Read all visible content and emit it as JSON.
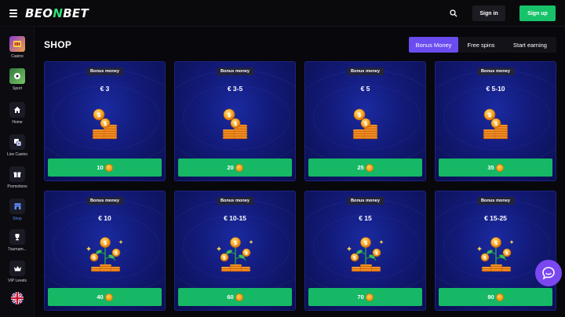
{
  "header": {
    "brand_main": "BEO",
    "brand_accent": "N",
    "brand_end": "BET",
    "signin_label": "Sign in",
    "signup_label": "Sign up"
  },
  "sidebar": {
    "items": [
      {
        "label": "Casino",
        "icon": "slot-machine-icon"
      },
      {
        "label": "Sport",
        "icon": "football-field-icon"
      },
      {
        "label": "Home",
        "icon": "home-icon"
      },
      {
        "label": "Live Casino",
        "icon": "dice-icon"
      },
      {
        "label": "Promotions",
        "icon": "gift-icon"
      },
      {
        "label": "Shop",
        "icon": "shop-icon"
      },
      {
        "label": "Tournam...",
        "icon": "trophy-icon"
      },
      {
        "label": "VIP Levels",
        "icon": "crown-icon"
      }
    ],
    "language_icon": "uk-flag-icon"
  },
  "page": {
    "title": "SHOP"
  },
  "tabs": [
    {
      "label": "Bonus Money",
      "active": true
    },
    {
      "label": "Free spins",
      "active": false
    },
    {
      "label": "Start earning",
      "active": false
    }
  ],
  "cards": [
    {
      "badge": "Bonus money",
      "amount": "€ 3",
      "price": "10"
    },
    {
      "badge": "Bonus money",
      "amount": "€ 3-5",
      "price": "20"
    },
    {
      "badge": "Bonus money",
      "amount": "€ 5",
      "price": "25"
    },
    {
      "badge": "Bonus money",
      "amount": "€ 5-10",
      "price": "35"
    },
    {
      "badge": "Bonus money",
      "amount": "€ 10",
      "price": "40"
    },
    {
      "badge": "Bonus money",
      "amount": "€ 10-15",
      "price": "60"
    },
    {
      "badge": "Bonus money",
      "amount": "€ 15",
      "price": "70"
    },
    {
      "badge": "Bonus money",
      "amount": "€ 15-25",
      "price": "90"
    }
  ],
  "colors": {
    "accent_green": "#17c26a",
    "tab_active": "#6a4cf0",
    "card_bg": "#121a78",
    "chat_bubble": "#7a47f0"
  }
}
